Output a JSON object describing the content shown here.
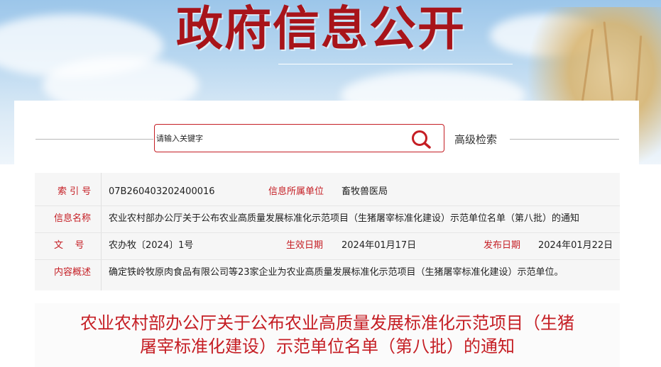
{
  "banner": {
    "title": "政府信息公开"
  },
  "search": {
    "placeholder": "请输入关键字",
    "advanced_label": "高级检索"
  },
  "meta": {
    "index_label": "索 引 号",
    "index_value": "07B260403202400016",
    "category_label": "信息所属单位",
    "category_value": "畜牧兽医局",
    "name_label": "信息名称",
    "name_value": "农业农村部办公厅关于公布农业高质量发展标准化示范项目（生猪屠宰标准化建设）示范单位名单（第八批）的通知",
    "doc_label": "文    号",
    "doc_value": "农办牧〔2024〕1号",
    "effective_label": "生效日期",
    "effective_value": "2024年01月17日",
    "publish_label": "发布日期",
    "publish_value": "2024年01月22日",
    "summary_label": "内容概述",
    "summary_value": "确定铁岭牧原肉食品有限公司等23家企业为农业高质量发展标准化示范项目（生猪屠宰标准化建设）示范单位。"
  },
  "article": {
    "title_line1": "农业农村部办公厅关于公布农业高质量发展标准化示范项目（生猪",
    "title_line2": "屠宰标准化建设）示范单位名单（第八批）的通知"
  },
  "colors": {
    "accent": "#c51e24",
    "banner_title": "#a8141a",
    "label": "#c51e24",
    "text": "#222222"
  },
  "icons": {
    "search": "search-icon"
  }
}
